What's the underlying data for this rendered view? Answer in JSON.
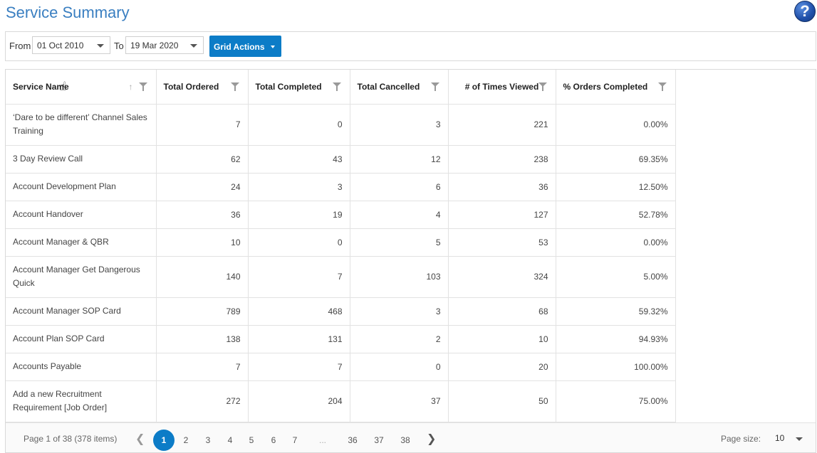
{
  "header": {
    "title": "Service Summary",
    "help_glyph": "?"
  },
  "toolbar": {
    "from_label": "From",
    "from_date": "01 Oct 2010",
    "to_label": "To",
    "to_date": "19 Mar 2020",
    "grid_actions_label": "Grid Actions"
  },
  "grid": {
    "columns": [
      "Service Name",
      "Total Ordered",
      "Total Completed",
      "Total Cancelled",
      "# of Times Viewed",
      "% Orders Completed"
    ],
    "rows": [
      [
        "‘Dare to be different’ Channel Sales Training",
        "7",
        "0",
        "3",
        "221",
        "0.00%"
      ],
      [
        "3 Day Review Call",
        "62",
        "43",
        "12",
        "238",
        "69.35%"
      ],
      [
        "Account Development Plan",
        "24",
        "3",
        "6",
        "36",
        "12.50%"
      ],
      [
        "Account Handover",
        "36",
        "19",
        "4",
        "127",
        "52.78%"
      ],
      [
        "Account Manager & QBR",
        "10",
        "0",
        "5",
        "53",
        "0.00%"
      ],
      [
        "Account Manager Get Dangerous Quick",
        "140",
        "7",
        "103",
        "324",
        "5.00%"
      ],
      [
        "Account Manager SOP Card",
        "789",
        "468",
        "3",
        "68",
        "59.32%"
      ],
      [
        "Account Plan SOP Card",
        "138",
        "131",
        "2",
        "10",
        "94.93%"
      ],
      [
        "Accounts Payable",
        "7",
        "7",
        "0",
        "20",
        "100.00%"
      ],
      [
        "Add a new Recruitment Requirement [Job Order]",
        "272",
        "204",
        "37",
        "50",
        "75.00%"
      ]
    ]
  },
  "pager": {
    "info": "Page 1 of 38 (378 items)",
    "pages": [
      "1",
      "2",
      "3",
      "4",
      "5",
      "6",
      "7",
      "...",
      "36",
      "37",
      "38"
    ],
    "current_page": "1",
    "page_size_label": "Page size:",
    "page_size": "10"
  },
  "icons": {
    "help": "help-icon",
    "sort": "sort-arrow-icon",
    "filter": "funnel-icon",
    "prev": "chevron-left-icon",
    "next": "chevron-right-icon",
    "cursor": "hand-cursor-icon"
  },
  "colors": {
    "title": "#3a7fc1",
    "accent": "#0c7cc7"
  }
}
